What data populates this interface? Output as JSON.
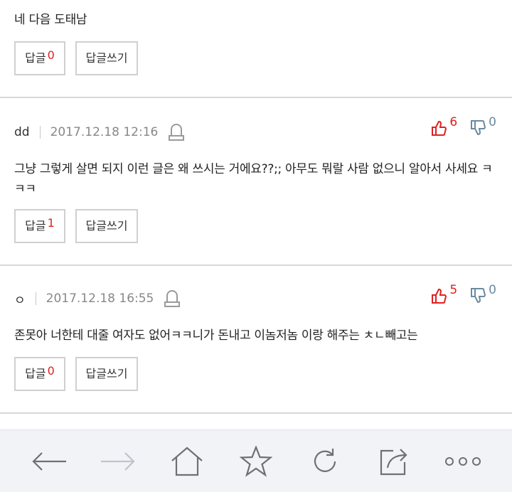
{
  "top_comment": {
    "text": "네 다음 도태남",
    "reply_label": "답글",
    "reply_count": "0",
    "write_label": "답글쓰기"
  },
  "comments": [
    {
      "author": "dd",
      "date": "2017.12.18 12:16",
      "up_count": "6",
      "down_count": "0",
      "text": "그냥 그렇게 살면 되지 이런 글은 왜 쓰시는 거에요??;; 아무도 뭐랄 사람 없으니 알아서 사세요 ㅋㅋㅋ",
      "reply_label": "답글",
      "reply_count": "1",
      "write_label": "답글쓰기"
    },
    {
      "author": "ㅇ",
      "date": "2017.12.18 16:55",
      "up_count": "5",
      "down_count": "0",
      "text": "존못아 너한테 대줄 여자도 없어ㅋㅋ니가 돈내고 이놈저놈 이랑 해주는 ㅊㄴ빼고는",
      "reply_label": "답글",
      "reply_count": "0",
      "write_label": "답글쓰기"
    }
  ],
  "colors": {
    "accent_red": "#e02020",
    "down_blue": "#6a8aa0",
    "toolbar_bg": "#f2f3f7"
  },
  "toolbar_icons": [
    "back-arrow-icon",
    "forward-arrow-icon",
    "home-icon",
    "star-icon",
    "refresh-icon",
    "share-icon",
    "more-icon"
  ]
}
